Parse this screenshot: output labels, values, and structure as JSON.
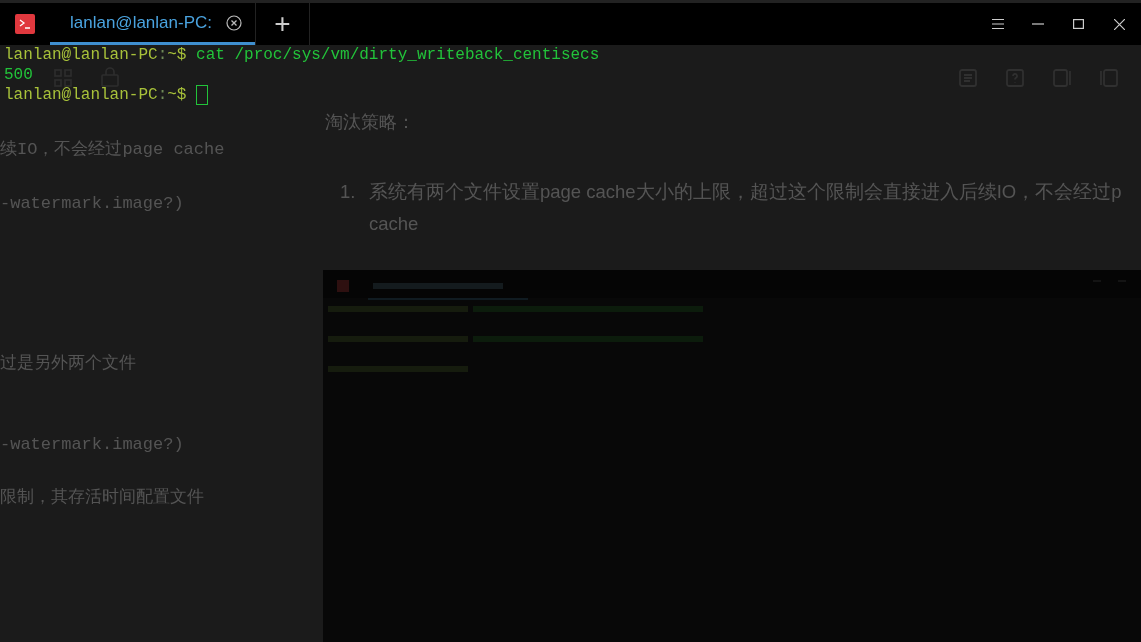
{
  "editor": {
    "left_texts": [
      "续IO，不会经过page cache",
      "-watermark.image?)",
      "过是另外两个文件",
      "-watermark.image?)",
      "限制，其存活时间配置文件"
    ],
    "heading": "淘汰策略：",
    "list_items": [
      {
        "number": "1.",
        "lines": [
          "系统有两个文件设置page cache大小的上限，超过这个限制会直接进入后续IO，不会经过p",
          "cache"
        ]
      }
    ]
  },
  "terminal": {
    "tabs": [
      {
        "title": "lanlan@lanlan-PC:",
        "selected": true
      }
    ],
    "new_tab": "+",
    "lines": [
      {
        "segments": [
          {
            "kind": "user",
            "text": "lanlan@lanlan-PC"
          },
          {
            "kind": "sep",
            "text": ":"
          },
          {
            "kind": "path",
            "text": "~$"
          },
          {
            "kind": "command",
            "text": " cat /proc/sys/vm/dirty_writeback_centisecs"
          }
        ]
      },
      {
        "segments": [
          {
            "kind": "output",
            "text": "500"
          }
        ]
      },
      {
        "segments": [
          {
            "kind": "user",
            "text": "lanlan@lanlan-PC"
          },
          {
            "kind": "sep",
            "text": ":"
          },
          {
            "kind": "path",
            "text": "~$"
          }
        ],
        "cursor": true
      }
    ]
  }
}
